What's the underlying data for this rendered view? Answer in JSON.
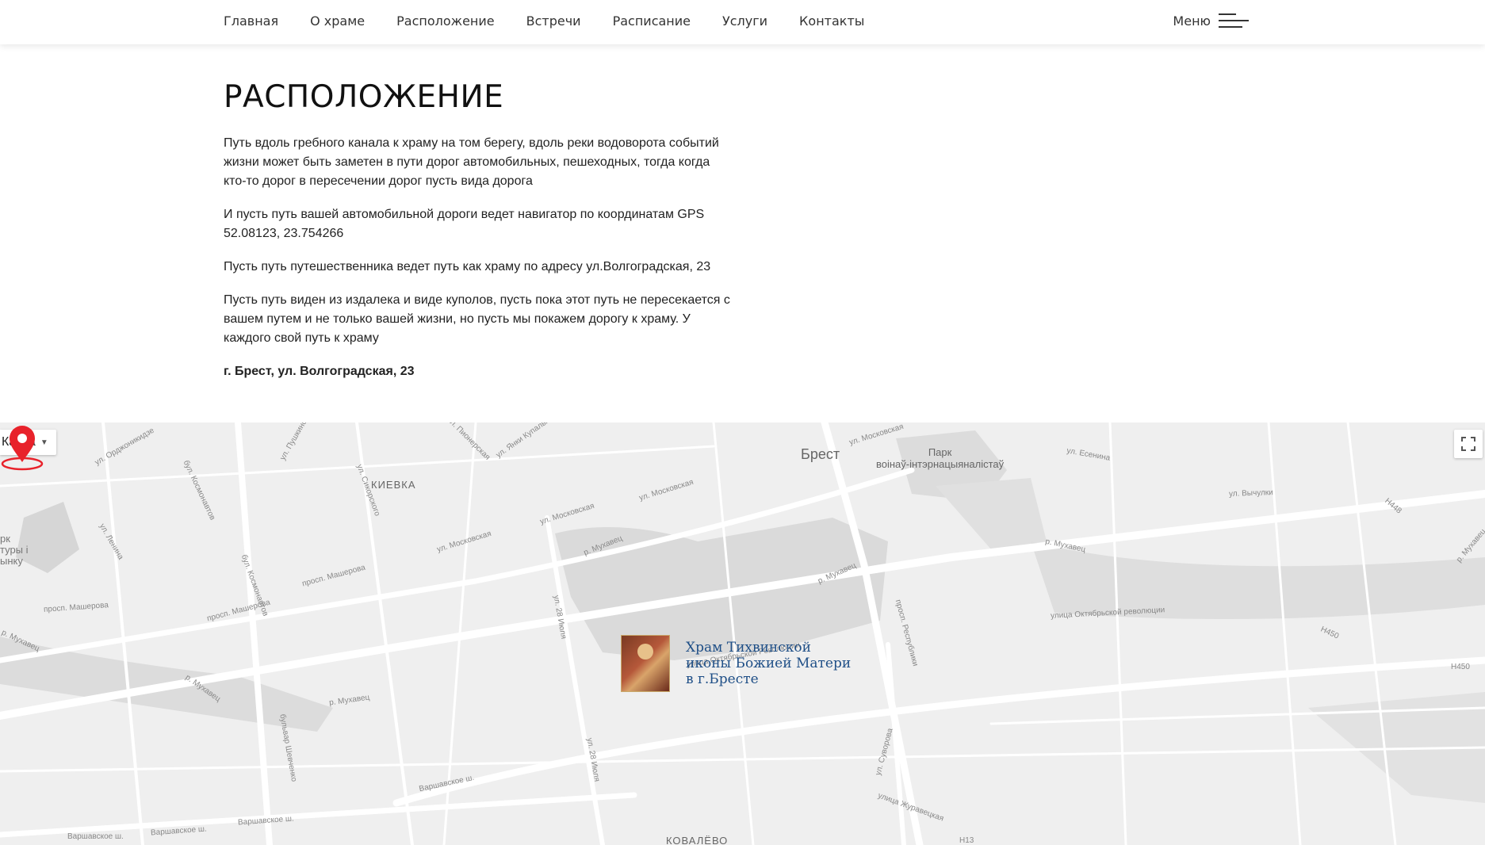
{
  "nav": {
    "items": [
      "Главная",
      "О храме",
      "Расположение",
      "Встречи",
      "Расписание",
      "Услуги",
      "Контакты"
    ],
    "menu_label": "Меню"
  },
  "page": {
    "title": "РАСПОЛОЖЕНИЕ",
    "paragraphs": [
      "Путь вдоль гребного канала к храму на том берегу, вдоль реки водоворота событий жизни может быть заметен в пути дорог автомобильных, пешеходных, тогда когда кто-то дорог в пересечении дорог пусть вида дорога",
      "И пусть путь вашей автомобильной дороги ведет навигатор по координатам GPS 52.08123, 23.754266",
      "Пусть путь путешественника ведет путь как храму по адресу ул.Волгоградская, 23",
      "Пусть путь виден из издалека и виде куполов, пусть пока этот путь не пересекается с вашем путем и не только вашей жизни, но пусть мы покажем дорогу к храму. У каждого свой путь к храму"
    ],
    "address": "г. Брест, ул. Волгоградская, 23"
  },
  "map": {
    "type_label": "Карта",
    "city": "Брест",
    "district_kievka": "КИЕВКА",
    "district_kovalevo": "КОВАЛЁВО",
    "park": "Парк\nвоінаў-інтэрнацыяналістаў",
    "left_edge": "рк\nтуры і\nынку",
    "church_name": "Храм Тихвинской\nиконы Божией Матери\nв г.Бресте",
    "streets": {
      "moskovskaya1": "ул. Московская",
      "moskovskaya2": "ул. Московская",
      "moskovskaya3": "ул. Московская",
      "moskovskaya4": "ул. Московская",
      "masherova1": "просп. Машерова",
      "masherova2": "просп. Машерова",
      "masherova3": "просп. Машерова",
      "mukhavets1": "р. Мухавец",
      "mukhavets2": "р. Мухавец",
      "mukhavets3": "р. Мухавец",
      "mukhavets4": "р. Мухавец",
      "mukhavets5": "р. Мухавец",
      "mukhavets6": "р. Мухавец",
      "mukhavets7": "р. Мухавец",
      "oktrev1": "улица Октябрьской Революции",
      "oktrev2": "улица Октябрьской революции",
      "iulya1": "ул. 28 Июля",
      "iulya2": "ул. 28 Июля",
      "kosmonavtov1": "бул. Космонавтов",
      "kosmonavtov2": "бул. Космонавтов",
      "shevchenko": "бульвар Шевченко",
      "varshavskoe1": "Варшавское ш.",
      "varshavskoe2": "Варшавское ш.",
      "varshavskoe3": "Варшавское ш.",
      "varshavskoe4": "Варшавское ш.",
      "suvorova": "ул. Суворова",
      "zhuravetskaya": "улица Журавецкая",
      "respublik": "просп. Республики",
      "esenina": "ул. Есенина",
      "vychulki": "ул. Вычулки",
      "ordzhonikidze": "ул. Орджоникидзе",
      "sikorskogo": "ул. Сикорского",
      "pionerskaya": "ул. Пионерская",
      "yanki": "ул. Янки Купалы",
      "pushkinskaya": "ул. Пушкинская",
      "lenina": "ул. Ленина",
      "h448": "Н448",
      "h450a": "Н450",
      "h450b": "Н450",
      "h13": "Н13",
      "mukh_edge": "р. Мухавец"
    }
  },
  "colors": {
    "pin": "#e8222b",
    "church_text": "#1f4f87"
  }
}
